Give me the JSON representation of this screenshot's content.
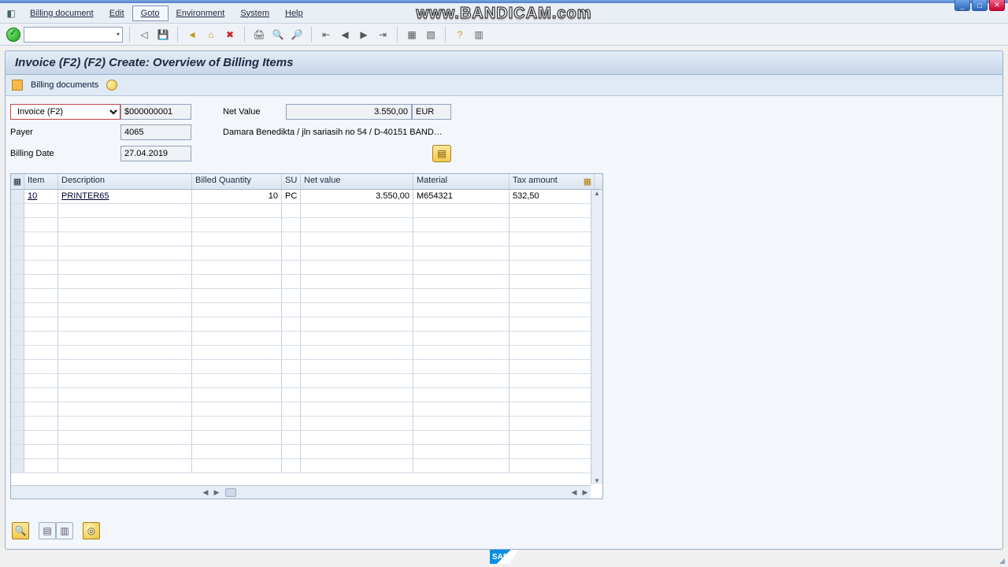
{
  "watermark": "www.BANDICAM.com",
  "menu": {
    "items": [
      "Billing document",
      "Edit",
      "Goto",
      "Environment",
      "System",
      "Help"
    ]
  },
  "page_title": "Invoice (F2)  (F2) Create: Overview of Billing Items",
  "subbar": {
    "label": "Billing documents"
  },
  "header": {
    "doc_type": "Invoice (F2)",
    "doc_number": "$000000001",
    "net_value_label": "Net Value",
    "net_value": "3.550,00",
    "currency": "EUR",
    "payer_label": "Payer",
    "payer": "4065",
    "payer_text": "Damara Benedikta / jln sariasih no 54 / D-40151 BAND…",
    "billdate_label": "Billing Date",
    "billdate": "27.04.2019"
  },
  "table": {
    "columns": [
      "Item",
      "Description",
      "Billed Quantity",
      "SU",
      "Net value",
      "Material",
      "Tax amount"
    ],
    "rows": [
      {
        "item": "10",
        "desc": "PRINTER65",
        "qty": "10",
        "su": "PC",
        "nv": "3.550,00",
        "mat": "M654321",
        "tax": "532,50"
      }
    ]
  },
  "sap": "SAP"
}
